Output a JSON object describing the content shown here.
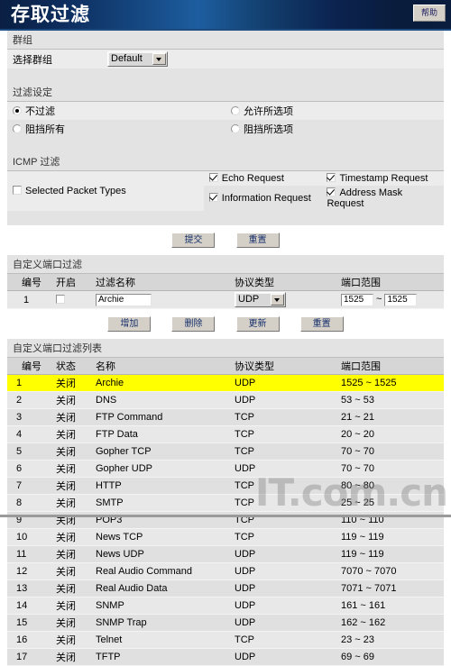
{
  "header": {
    "title": "存取过滤",
    "help_label": "帮助"
  },
  "group_section": {
    "section_title": "群组",
    "label": "选择群组",
    "selected": "Default"
  },
  "filter_settings": {
    "section_title": "过滤设定",
    "options": [
      {
        "label": "不过滤",
        "selected": true
      },
      {
        "label": "允许所选项",
        "selected": false
      },
      {
        "label": "阻挡所有",
        "selected": false
      },
      {
        "label": "阻挡所选项",
        "selected": false
      }
    ]
  },
  "icmp_section": {
    "section_title": "ICMP 过滤",
    "selected_packet_types": {
      "label": "Selected Packet Types",
      "checked": false
    },
    "packet_types": [
      {
        "label": "Echo Request",
        "checked": true
      },
      {
        "label": "Timestamp Request",
        "checked": true
      },
      {
        "label": "Information Request",
        "checked": true
      },
      {
        "label": "Address Mask Request",
        "checked": true
      }
    ]
  },
  "buttons_top": [
    {
      "label": "提交",
      "name": "submit-button"
    },
    {
      "label": "重置",
      "name": "reset-button"
    }
  ],
  "custom_port_filter": {
    "section_title": "自定义端口过滤",
    "columns": [
      "编号",
      "开启",
      "过滤名称",
      "协议类型",
      "端口范围"
    ],
    "row": {
      "id": "1",
      "enabled": false,
      "name_value": "Archie",
      "protocol": "UDP",
      "port_start": "1525",
      "port_sep": "~",
      "port_end": "1525"
    }
  },
  "buttons_mid": [
    {
      "label": "增加",
      "name": "add-button"
    },
    {
      "label": "删除",
      "name": "delete-button"
    },
    {
      "label": "更新",
      "name": "update-button"
    },
    {
      "label": "重置",
      "name": "reset-list-button"
    }
  ],
  "filter_list": {
    "section_title": "自定义端口过滤列表",
    "columns": [
      "编号",
      "状态",
      "名称",
      "协议类型",
      "端口范围"
    ],
    "rows": [
      {
        "id": "1",
        "status": "关闭",
        "name": "Archie",
        "protocol": "UDP",
        "range": "1525 ~ 1525",
        "highlighted": true
      },
      {
        "id": "2",
        "status": "关闭",
        "name": "DNS",
        "protocol": "UDP",
        "range": "53 ~ 53"
      },
      {
        "id": "3",
        "status": "关闭",
        "name": "FTP Command",
        "protocol": "TCP",
        "range": "21 ~ 21"
      },
      {
        "id": "4",
        "status": "关闭",
        "name": "FTP Data",
        "protocol": "TCP",
        "range": "20 ~ 20"
      },
      {
        "id": "5",
        "status": "关闭",
        "name": "Gopher TCP",
        "protocol": "TCP",
        "range": "70 ~ 70"
      },
      {
        "id": "6",
        "status": "关闭",
        "name": "Gopher UDP",
        "protocol": "UDP",
        "range": "70 ~ 70"
      },
      {
        "id": "7",
        "status": "关闭",
        "name": "HTTP",
        "protocol": "TCP",
        "range": "80 ~ 80"
      },
      {
        "id": "8",
        "status": "关闭",
        "name": "SMTP",
        "protocol": "TCP",
        "range": "25 ~ 25"
      },
      {
        "id": "9",
        "status": "关闭",
        "name": "POP3",
        "protocol": "TCP",
        "range": "110 ~ 110"
      },
      {
        "id": "10",
        "status": "关闭",
        "name": "News TCP",
        "protocol": "TCP",
        "range": "119 ~ 119"
      },
      {
        "id": "11",
        "status": "关闭",
        "name": "News UDP",
        "protocol": "UDP",
        "range": "119 ~ 119"
      },
      {
        "id": "12",
        "status": "关闭",
        "name": "Real Audio Command",
        "protocol": "UDP",
        "range": "7070 ~ 7070"
      },
      {
        "id": "13",
        "status": "关闭",
        "name": "Real Audio Data",
        "protocol": "UDP",
        "range": "7071 ~ 7071"
      },
      {
        "id": "14",
        "status": "关闭",
        "name": "SNMP",
        "protocol": "UDP",
        "range": "161 ~ 161"
      },
      {
        "id": "15",
        "status": "关闭",
        "name": "SNMP Trap",
        "protocol": "UDP",
        "range": "162 ~ 162"
      },
      {
        "id": "16",
        "status": "关闭",
        "name": "Telnet",
        "protocol": "TCP",
        "range": "23 ~ 23"
      },
      {
        "id": "17",
        "status": "关闭",
        "name": "TFTP",
        "protocol": "UDP",
        "range": "69 ~ 69"
      }
    ]
  },
  "watermark": {
    "text": "IT.com.cn"
  }
}
